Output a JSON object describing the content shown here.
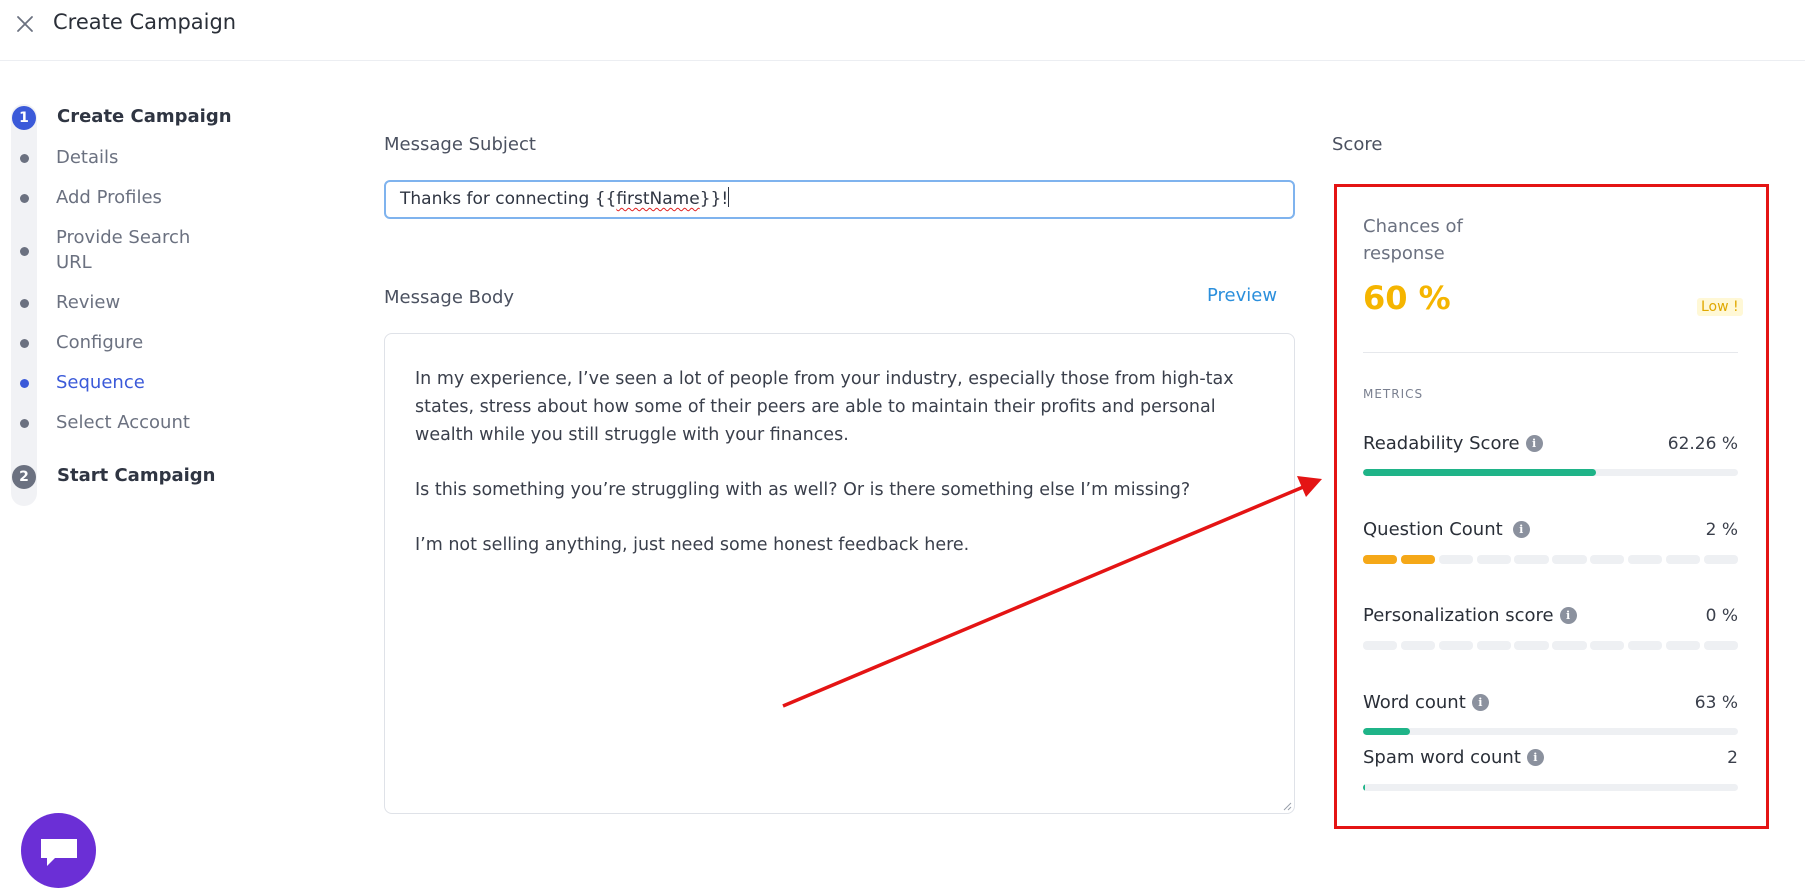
{
  "header": {
    "title": "Create Campaign"
  },
  "stepper": {
    "steps": [
      {
        "number": "1",
        "label": "Create Campaign"
      },
      {
        "number": "2",
        "label": "Start Campaign"
      }
    ],
    "substeps": [
      "Details",
      "Add Profiles",
      "Provide Search URL",
      "Review",
      "Configure",
      "Sequence",
      "Select Account"
    ],
    "current_substep": "Sequence"
  },
  "editor": {
    "subject_label": "Message Subject",
    "subject_prefix": "Thanks for connecting {{",
    "subject_var": "firstName",
    "subject_suffix": "}}!",
    "body_label": "Message Body",
    "preview_label": "Preview",
    "body_paragraphs": [
      "In my experience, I’ve seen a lot of people from your industry, especially those from high-tax states, stress about how some of their peers are able to maintain their profits and personal wealth while you still struggle with your finances.",
      "Is this something you’re struggling with as well? Or is there something else I’m missing?",
      "I’m not selling anything, just need some honest feedback here."
    ]
  },
  "score": {
    "section_label": "Score",
    "chances_label": "Chances of response",
    "chances_value": "60 %",
    "level_badge": "Low !",
    "metrics_title": "METRICS",
    "metrics": [
      {
        "name": "Readability Score",
        "value": "62.26 %",
        "fraction": 0.6226,
        "style": "bar"
      },
      {
        "name": "Question Count",
        "value": "2 %",
        "segments_on": 2,
        "segments_total": 10,
        "style": "segments"
      },
      {
        "name": "Personalization score",
        "value": "0 %",
        "segments_on": 0,
        "segments_total": 10,
        "style": "segments"
      },
      {
        "name": "Word count",
        "value": "63 %",
        "fraction": 0.125,
        "style": "bar"
      },
      {
        "name": "Spam word count",
        "value": "2",
        "fraction": 0.005,
        "style": "bar"
      }
    ],
    "info_glyph": "i"
  },
  "colors": {
    "accent": "#3b5ad9",
    "score_yellow": "#f5b500",
    "bar_green": "#1fb488",
    "segment_orange": "#f5a818",
    "annotation_red": "#e41414",
    "chat_purple": "#6b2fd6"
  },
  "icons": {
    "close": "close-icon",
    "chat": "chat-bubble-icon",
    "info": "info-icon"
  }
}
